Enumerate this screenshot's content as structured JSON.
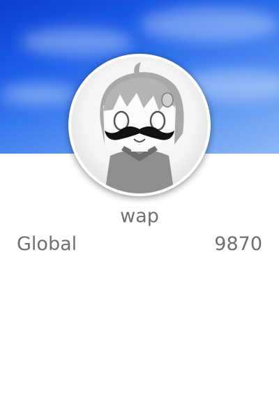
{
  "profile": {
    "username": "wap",
    "stat": {
      "label": "Global",
      "value": "9870"
    },
    "avatar_icon": "mustache-character-avatar",
    "banner_colors": [
      "#0b3fd0",
      "#3f7ff0",
      "#8fb7f5"
    ]
  }
}
